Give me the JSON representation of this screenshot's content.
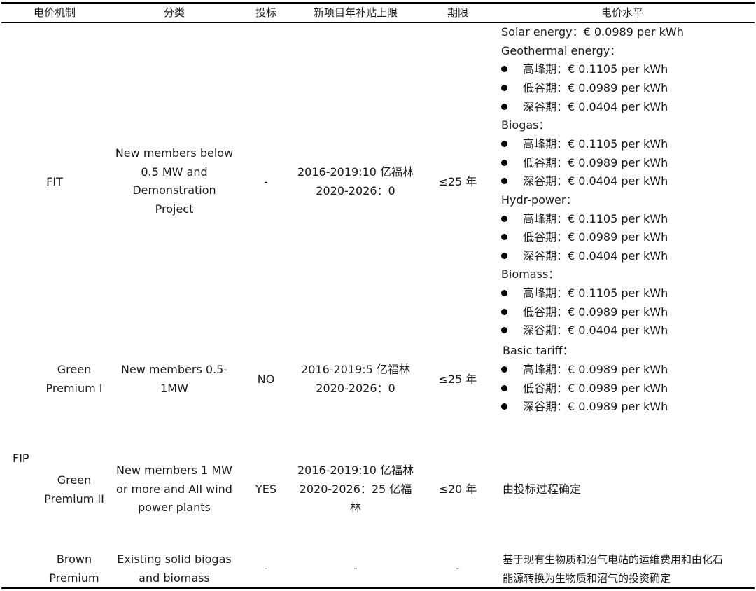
{
  "header": {
    "mechanism": "电价机制",
    "category": "分类",
    "bidding": "投标",
    "subsidy_cap": "新项目年补贴上限",
    "term": "期限",
    "price_level": "电价水平"
  },
  "group_fip": "FIP",
  "rows": [
    {
      "mechanism": "FIT",
      "category_lines": [
        "New members below",
        "0.5 MW and",
        "Demonstration",
        "Project"
      ],
      "bidding": "-",
      "subsidy_lines": [
        "2016-2019:10 亿福林",
        "2020-2026：0"
      ],
      "term": "≤25 年"
    },
    {
      "mechanism_lines": [
        "Green",
        "Premium I"
      ],
      "category_lines": [
        "New members 0.5-",
        "1MW"
      ],
      "bidding": "NO",
      "subsidy_lines": [
        "2016-2019:5 亿福林",
        "2020-2026：0"
      ],
      "term": "≤25 年"
    },
    {
      "mechanism_lines": [
        "Green",
        "Premium II"
      ],
      "category_lines": [
        "New members 1 MW",
        "or more and All wind",
        "power plants"
      ],
      "bidding": "YES",
      "subsidy_lines": [
        "2016-2019:10 亿福林",
        "2020-2026：25 亿福",
        "林"
      ],
      "term": "≤20 年",
      "price": "由投标过程确定"
    },
    {
      "mechanism_lines": [
        "Brown",
        "Premium"
      ],
      "category_lines": [
        "Existing solid biogas",
        "and biomass"
      ],
      "bidding": "-",
      "subsidy": "-",
      "term": "-",
      "price_lines": [
        "基于现有生物质和沼气电站的运维费用和由化石",
        "能源转换为生物质和沼气的投资确定"
      ]
    }
  ],
  "fit_prices": {
    "solar": "Solar energy：€ 0.0989 per kWh",
    "groups": [
      {
        "title": "Geothermal energy：",
        "items": [
          "高峰期：€ 0.1105 per kWh",
          "低谷期：€ 0.0989 per kWh",
          "深谷期：€ 0.0404 per kWh"
        ]
      },
      {
        "title": "Biogas：",
        "items": [
          "高峰期：€ 0.1105 per kWh",
          "低谷期：€ 0.0989 per kWh",
          "深谷期：€ 0.0404 per kWh"
        ]
      },
      {
        "title": "Hydr-power：",
        "items": [
          "高峰期：€ 0.1105 per kWh",
          "低谷期：€ 0.0989 per kWh",
          "深谷期：€ 0.0404 per kWh"
        ]
      },
      {
        "title": "Biomass：",
        "items": [
          "高峰期：€ 0.1105 per kWh",
          "低谷期：€ 0.0989 per kWh",
          "深谷期：€ 0.0404 per kWh"
        ]
      }
    ]
  },
  "gp1_prices": {
    "title": "Basic tariff：",
    "items": [
      "高峰期：€ 0.0989 per kWh",
      "低谷期：€ 0.0989 per kWh",
      "深谷期：€ 0.0989 per kWh"
    ]
  }
}
